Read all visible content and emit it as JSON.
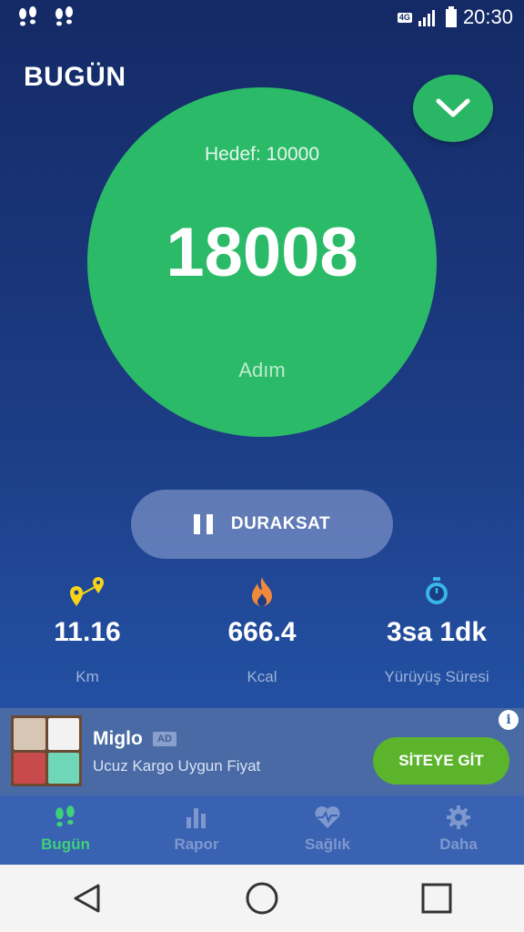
{
  "status_bar": {
    "time": "20:30",
    "network": "4G",
    "icons": [
      "footsteps-icon",
      "footsteps-icon",
      "network-icon",
      "signal-icon",
      "battery-icon"
    ]
  },
  "header": {
    "title": "BUGÜN",
    "action_icon": "chevron-down-icon"
  },
  "step_circle": {
    "goal_text": "Hedef: 10000",
    "steps": "18008",
    "unit": "Adım",
    "color": "#2bbb68"
  },
  "pause_button": {
    "label": "DURAKSAT",
    "icon": "pause-icon"
  },
  "stats": [
    {
      "value": "11.16",
      "label": "Km",
      "icon": "route-pin-icon",
      "color": "#f5d31a"
    },
    {
      "value": "666.4",
      "label": "Kcal",
      "icon": "flame-icon",
      "color": "#f08a3a"
    },
    {
      "value": "3sa 1dk",
      "label": "Yürüyüş Süresi",
      "icon": "stopwatch-icon",
      "color": "#38b6e8"
    }
  ],
  "ad": {
    "title": "Miglo",
    "badge": "AD",
    "subtitle": "Ucuz Kargo Uygun Fiyat",
    "button": "SİTEYE GİT",
    "info_icon": "info-icon"
  },
  "tabs": [
    {
      "label": "Bugün",
      "icon": "footsteps-icon",
      "active": true
    },
    {
      "label": "Rapor",
      "icon": "bar-chart-icon",
      "active": false
    },
    {
      "label": "Sağlık",
      "icon": "heart-pulse-icon",
      "active": false
    },
    {
      "label": "Daha",
      "icon": "gear-icon",
      "active": false
    }
  ],
  "colors": {
    "accent_green": "#2ab765",
    "active_tab": "#3ed17a",
    "inactive_tab": "#7e98ce",
    "ad_button": "#5bb42c"
  }
}
